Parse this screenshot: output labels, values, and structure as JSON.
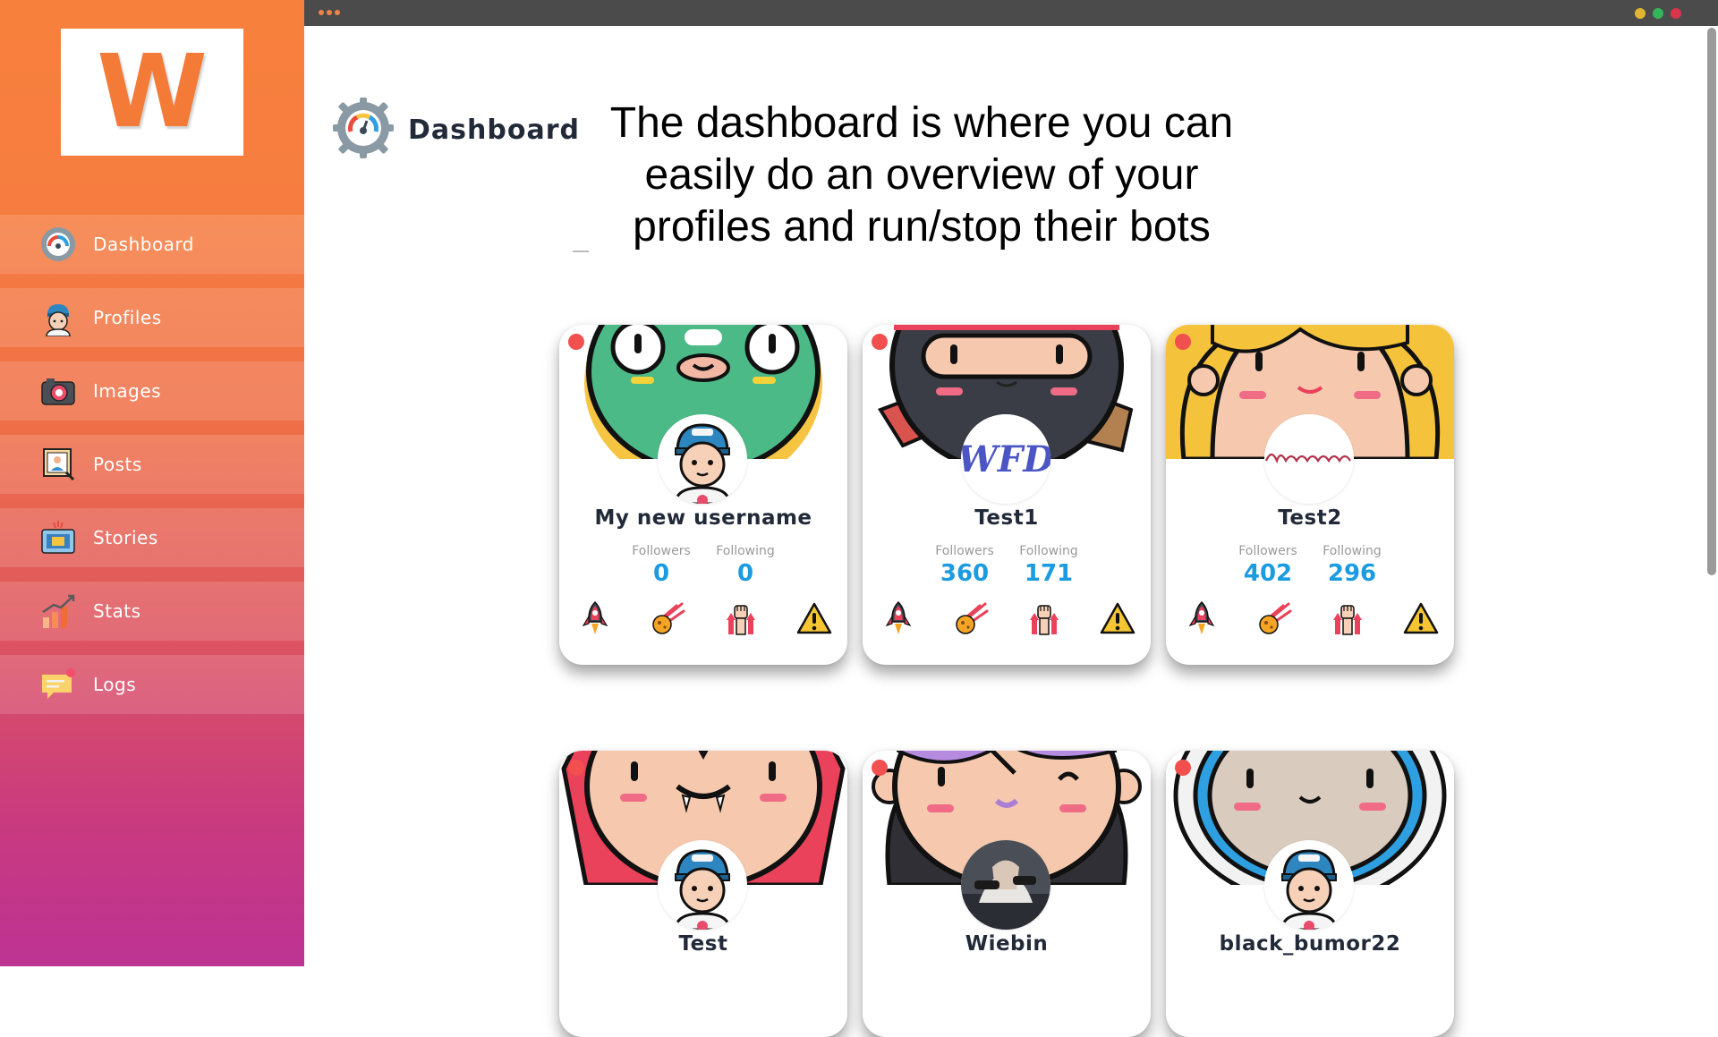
{
  "sidebar": {
    "logo_letter": "W",
    "items": [
      {
        "label": "Dashboard",
        "icon": "gauge-icon"
      },
      {
        "label": "Profiles",
        "icon": "user-cap-icon"
      },
      {
        "label": "Images",
        "icon": "camera-icon"
      },
      {
        "label": "Posts",
        "icon": "post-frame-icon"
      },
      {
        "label": "Stories",
        "icon": "stories-icon"
      },
      {
        "label": "Stats",
        "icon": "chart-icon"
      },
      {
        "label": "Logs",
        "icon": "chat-bubble-icon"
      }
    ]
  },
  "header": {
    "title": "Dashboard",
    "description": "The dashboard is where you can easily do an overview of your profiles and run/stop their bots"
  },
  "labels": {
    "followers": "Followers",
    "following": "Following"
  },
  "profiles": [
    {
      "name": "My new username",
      "followers": "0",
      "following": "0",
      "status": "stopped"
    },
    {
      "name": "Test1",
      "followers": "360",
      "following": "171",
      "status": "stopped"
    },
    {
      "name": "Test2",
      "followers": "402",
      "following": "296",
      "status": "stopped"
    },
    {
      "name": "Test",
      "status": "stopped"
    },
    {
      "name": "Wiebin",
      "status": "stopped"
    },
    {
      "name": "black_bumor22",
      "status": "stopped"
    }
  ],
  "colors": {
    "accent": "#f47a37",
    "stat_value": "#1b9be0",
    "status_stopped": "#f24f4f",
    "title_text": "#222a3a"
  },
  "actions": [
    "rocket-icon",
    "comet-icon",
    "raised-fists-icon",
    "warning-icon"
  ]
}
